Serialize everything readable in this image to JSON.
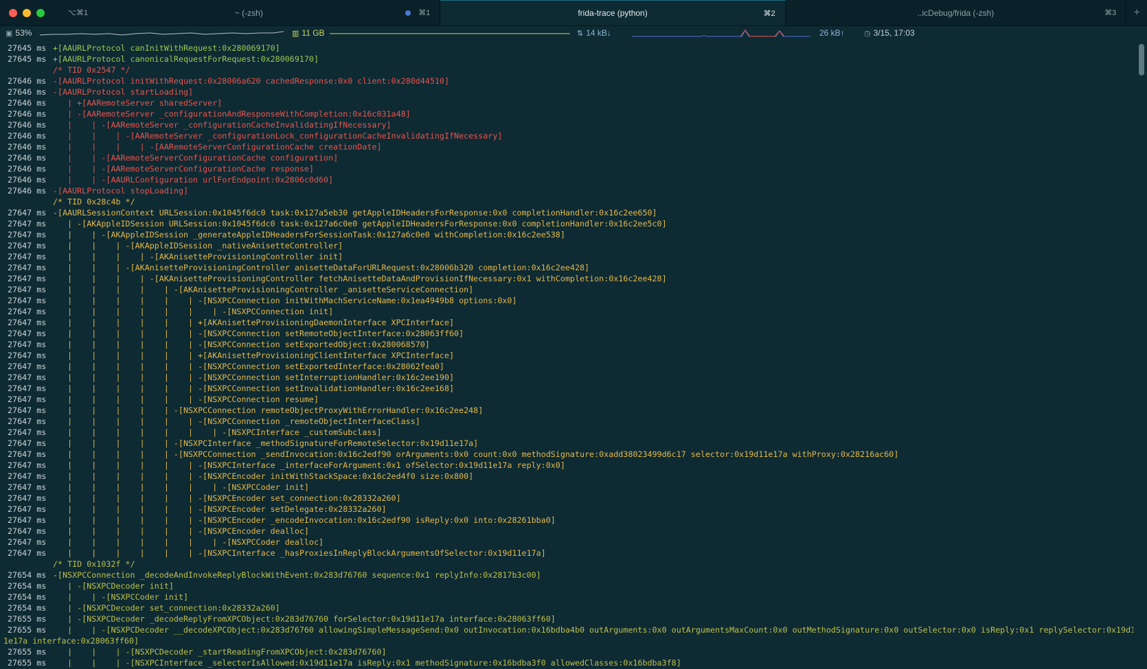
{
  "window": {
    "tabs": [
      {
        "label": "~ (-zsh)",
        "shortcut": "⌘1",
        "active": false
      },
      {
        "label": "frida-trace (python)",
        "shortcut": "⌘2",
        "active": true
      },
      {
        "label": "..icDebug/frida (-zsh)",
        "shortcut": "⌘3",
        "active": false
      }
    ],
    "left_shortcut": "⌥⌘1",
    "new_tab": "+"
  },
  "statusbar": {
    "cpu": "53%",
    "mem": "11 GB",
    "net_down": "14 kB↓",
    "net_up": "26 kB↑",
    "clock": "3/15, 17:03",
    "colors": {
      "cpu": "#c9d4d6",
      "mem": "#c9d86a",
      "net": "#8fb7d8",
      "spike": "#e8554e"
    }
  },
  "terminal": {
    "lines": [
      {
        "ts": "27645 ms",
        "text": "+[AAURLProtocol canInitWithRequest:0x280069170]",
        "color": "green"
      },
      {
        "ts": "27645 ms",
        "text": "+[AAURLProtocol canonicalRequestForRequest:0x280069170]",
        "color": "green"
      },
      {
        "ts": "",
        "text": "/* TID 0x2547 */",
        "color": "red"
      },
      {
        "ts": "27646 ms",
        "text": "-[AAURLProtocol initWithRequest:0x28006a620 cachedResponse:0x0 client:0x280d44510]",
        "color": "red"
      },
      {
        "ts": "27646 ms",
        "text": "-[AAURLProtocol startLoading]",
        "color": "red"
      },
      {
        "ts": "27646 ms",
        "text": "   | +[AARemoteServer sharedServer]",
        "color": "red"
      },
      {
        "ts": "27646 ms",
        "text": "   | -[AARemoteServer _configurationAndResponseWithCompletion:0x16c031a48]",
        "color": "red"
      },
      {
        "ts": "27646 ms",
        "text": "   |    | -[AARemoteServer _configurationCacheInvalidatingIfNecessary]",
        "color": "red"
      },
      {
        "ts": "27646 ms",
        "text": "   |    |    | -[AARemoteServer _configurationLock_configurationCacheInvalidatingIfNecessary]",
        "color": "red"
      },
      {
        "ts": "27646 ms",
        "text": "   |    |    |    | -[AARemoteServerConfigurationCache creationDate]",
        "color": "red"
      },
      {
        "ts": "27646 ms",
        "text": "   |    | -[AARemoteServerConfigurationCache configuration]",
        "color": "red"
      },
      {
        "ts": "27646 ms",
        "text": "   |    | -[AARemoteServerConfigurationCache response]",
        "color": "red"
      },
      {
        "ts": "27646 ms",
        "text": "   |    | -[AAURLConfiguration urlForEndpoint:0x2806c0d60]",
        "color": "red"
      },
      {
        "ts": "27646 ms",
        "text": "-[AAURLProtocol stopLoading]",
        "color": "red"
      },
      {
        "ts": "",
        "text": "/* TID 0x28c4b */",
        "color": "yellow"
      },
      {
        "ts": "27647 ms",
        "text": "-[AAURLSessionContext URLSession:0x1045f6dc0 task:0x127a5eb30 getAppleIDHeadersForResponse:0x0 completionHandler:0x16c2ee650]",
        "color": "yellow"
      },
      {
        "ts": "27647 ms",
        "text": "   | -[AKAppleIDSession URLSession:0x1045f6dc0 task:0x127a6c0e0 getAppleIDHeadersForResponse:0x0 completionHandler:0x16c2ee5c0]",
        "color": "yellow"
      },
      {
        "ts": "27647 ms",
        "text": "   |    | -[AKAppleIDSession _generateAppleIDHeadersForSessionTask:0x127a6c0e0 withCompletion:0x16c2ee538]",
        "color": "yellow"
      },
      {
        "ts": "27647 ms",
        "text": "   |    |    | -[AKAppleIDSession _nativeAnisetteController]",
        "color": "yellow"
      },
      {
        "ts": "27647 ms",
        "text": "   |    |    |    | -[AKAnisetteProvisioningController init]",
        "color": "yellow"
      },
      {
        "ts": "27647 ms",
        "text": "   |    |    | -[AKAnisetteProvisioningController anisetteDataForURLRequest:0x28006b320 completion:0x16c2ee428]",
        "color": "yellow"
      },
      {
        "ts": "27647 ms",
        "text": "   |    |    |    | -[AKAnisetteProvisioningController fetchAnisetteDataAndProvisionIfNecessary:0x1 withCompletion:0x16c2ee428]",
        "color": "yellow"
      },
      {
        "ts": "27647 ms",
        "text": "   |    |    |    |    | -[AKAnisetteProvisioningController _anisetteServiceConnection]",
        "color": "yellow"
      },
      {
        "ts": "27647 ms",
        "text": "   |    |    |    |    |    | -[NSXPCConnection initWithMachServiceName:0x1ea4949b8 options:0x0]",
        "color": "yellow"
      },
      {
        "ts": "27647 ms",
        "text": "   |    |    |    |    |    |    | -[NSXPCConnection init]",
        "color": "yellow"
      },
      {
        "ts": "27647 ms",
        "text": "   |    |    |    |    |    | +[AKAnisetteProvisioningDaemonInterface XPCInterface]",
        "color": "yellow"
      },
      {
        "ts": "27647 ms",
        "text": "   |    |    |    |    |    | -[NSXPCConnection setRemoteObjectInterface:0x28063ff60]",
        "color": "yellow"
      },
      {
        "ts": "27647 ms",
        "text": "   |    |    |    |    |    | -[NSXPCConnection setExportedObject:0x280068570]",
        "color": "yellow"
      },
      {
        "ts": "27647 ms",
        "text": "   |    |    |    |    |    | +[AKAnisetteProvisioningClientInterface XPCInterface]",
        "color": "yellow"
      },
      {
        "ts": "27647 ms",
        "text": "   |    |    |    |    |    | -[NSXPCConnection setExportedInterface:0x28062fea0]",
        "color": "yellow"
      },
      {
        "ts": "27647 ms",
        "text": "   |    |    |    |    |    | -[NSXPCConnection setInterruptionHandler:0x16c2ee190]",
        "color": "yellow"
      },
      {
        "ts": "27647 ms",
        "text": "   |    |    |    |    |    | -[NSXPCConnection setInvalidationHandler:0x16c2ee168]",
        "color": "yellow"
      },
      {
        "ts": "27647 ms",
        "text": "   |    |    |    |    |    | -[NSXPCConnection resume]",
        "color": "yellow"
      },
      {
        "ts": "27647 ms",
        "text": "   |    |    |    |    | -[NSXPCConnection remoteObjectProxyWithErrorHandler:0x16c2ee248]",
        "color": "yellow"
      },
      {
        "ts": "27647 ms",
        "text": "   |    |    |    |    |    | -[NSXPCConnection _remoteObjectInterfaceClass]",
        "color": "yellow"
      },
      {
        "ts": "27647 ms",
        "text": "   |    |    |    |    |    |    | -[NSXPCInterface _customSubclass]",
        "color": "yellow"
      },
      {
        "ts": "27647 ms",
        "text": "   |    |    |    |    | -[NSXPCInterface _methodSignatureForRemoteSelector:0x19d11e17a]",
        "color": "yellow"
      },
      {
        "ts": "27647 ms",
        "text": "   |    |    |    |    | -[NSXPCConnection _sendInvocation:0x16c2edf90 orArguments:0x0 count:0x0 methodSignature:0xadd38023499d6c17 selector:0x19d11e17a withProxy:0x28216ac60]",
        "color": "yellow"
      },
      {
        "ts": "27647 ms",
        "text": "   |    |    |    |    |    | -[NSXPCInterface _interfaceForArgument:0x1 ofSelector:0x19d11e17a reply:0x0]",
        "color": "yellow"
      },
      {
        "ts": "27647 ms",
        "text": "   |    |    |    |    |    | -[NSXPCEncoder initWithStackSpace:0x16c2ed4f0 size:0x800]",
        "color": "yellow"
      },
      {
        "ts": "27647 ms",
        "text": "   |    |    |    |    |    |    | -[NSXPCCoder init]",
        "color": "yellow"
      },
      {
        "ts": "27647 ms",
        "text": "   |    |    |    |    |    | -[NSXPCEncoder set_connection:0x28332a260]",
        "color": "yellow"
      },
      {
        "ts": "27647 ms",
        "text": "   |    |    |    |    |    | -[NSXPCEncoder setDelegate:0x28332a260]",
        "color": "yellow"
      },
      {
        "ts": "27647 ms",
        "text": "   |    |    |    |    |    | -[NSXPCEncoder _encodeInvocation:0x16c2edf90 isReply:0x0 into:0x28261bba0]",
        "color": "yellow"
      },
      {
        "ts": "27647 ms",
        "text": "   |    |    |    |    |    | -[NSXPCEncoder dealloc]",
        "color": "yellow"
      },
      {
        "ts": "27647 ms",
        "text": "   |    |    |    |    |    |    | -[NSXPCCoder dealloc]",
        "color": "yellow"
      },
      {
        "ts": "27647 ms",
        "text": "   |    |    |    |    |    | -[NSXPCInterface _hasProxiesInReplyBlockArgumentsOfSelector:0x19d11e17a]",
        "color": "yellow"
      },
      {
        "ts": "",
        "text": "/* TID 0x1032f */",
        "color": "olive"
      },
      {
        "ts": "27654 ms",
        "text": "-[NSXPCConnection _decodeAndInvokeReplyBlockWithEvent:0x283d76760 sequence:0x1 replyInfo:0x2817b3c00]",
        "color": "olive"
      },
      {
        "ts": "27654 ms",
        "text": "   | -[NSXPCDecoder init]",
        "color": "olive"
      },
      {
        "ts": "27654 ms",
        "text": "   |    | -[NSXPCCoder init]",
        "color": "olive"
      },
      {
        "ts": "27654 ms",
        "text": "   | -[NSXPCDecoder set_connection:0x28332a260]",
        "color": "olive"
      },
      {
        "ts": "27655 ms",
        "text": "   | -[NSXPCDecoder _decodeReplyFromXPCObject:0x283d76760 forSelector:0x19d11e17a interface:0x28063ff60]",
        "color": "olive"
      },
      {
        "ts": "27655 ms",
        "text": "   |    | -[NSXPCDecoder __decodeXPCObject:0x283d76760 allowingSimpleMessageSend:0x0 outInvocation:0x16bdba4b0 outArguments:0x0 outArgumentsMaxCount:0x0 outMethodSignature:0x0 outSelector:0x0 isReply:0x1 replySelector:0x19d1",
        "color": "olive"
      },
      {
        "ts": "",
        "text": "1e17a interface:0x28063ff60]",
        "color": "olive",
        "wrap": true
      },
      {
        "ts": "27655 ms",
        "text": "   |    |    | -[NSXPCDecoder _startReadingFromXPCObject:0x283d76760]",
        "color": "olive"
      },
      {
        "ts": "27655 ms",
        "text": "   |    |    | -[NSXPCInterface _selectorIsAllowed:0x19d11e17a isReply:0x1 methodSignature:0x16bdba3f0 allowedClasses:0x16bdba3f8]",
        "color": "olive"
      }
    ]
  }
}
